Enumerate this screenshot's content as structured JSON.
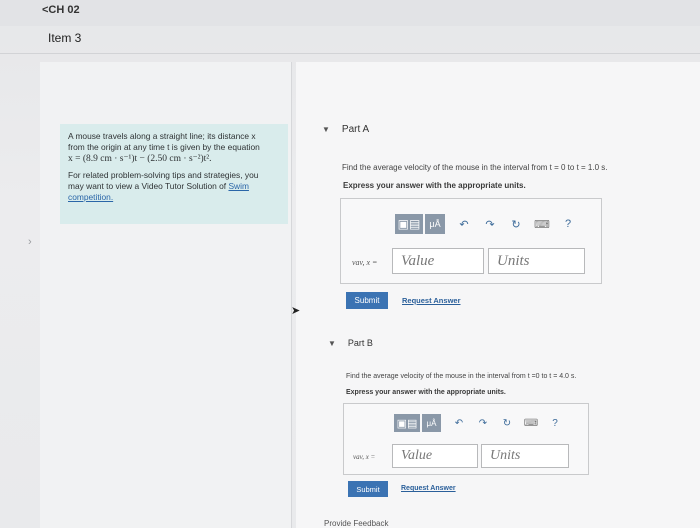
{
  "nav": {
    "back_label": "<CH 02"
  },
  "item": {
    "title": "Item 3"
  },
  "problem": {
    "line1": "A mouse travels along a straight line; its distance x",
    "line2": "from the origin at any time t is given by the equation",
    "equation": "x = (8.9 cm · s⁻¹)t − (2.50 cm · s⁻²)t².",
    "tip_line1": "For related problem-solving tips and strategies, you",
    "tip_line2": "may want to view a Video Tutor Solution of",
    "tip_link": "Swim competition."
  },
  "partA": {
    "label": "Part A",
    "question": "Find the average velocity of the mouse in the interval from t = 0 to t = 1.0 s.",
    "instruction": "Express your answer with the appropriate units.",
    "eq_label": "vav, x =",
    "value_placeholder": "Value",
    "units_placeholder": "Units",
    "submit_label": "Submit",
    "request_label": "Request Answer",
    "mu_label": "μÅ",
    "help_label": "?"
  },
  "partB": {
    "label": "Part B",
    "question": "Find the average velocity of the mouse in the interval from t =0 to t = 4.0 s.",
    "instruction": "Express your answer with the appropriate units.",
    "eq_label": "vav, x =",
    "value_placeholder": "Value",
    "units_placeholder": "Units",
    "submit_label": "Submit",
    "request_label": "Request Answer",
    "mu_label": "μÅ",
    "help_label": "?"
  },
  "footer": {
    "feedback_label": "Provide Feedback"
  },
  "icons": {
    "caret_down": "▼",
    "nav_arrow": "›",
    "undo": "↶",
    "redo": "↷",
    "reset": "↻",
    "keyboard": "⌨",
    "cursor": "➤"
  },
  "colors": {
    "accent": "#3b73b3",
    "problem_bg": "#d9ecec",
    "toolbar_btn": "#8a98a8"
  }
}
